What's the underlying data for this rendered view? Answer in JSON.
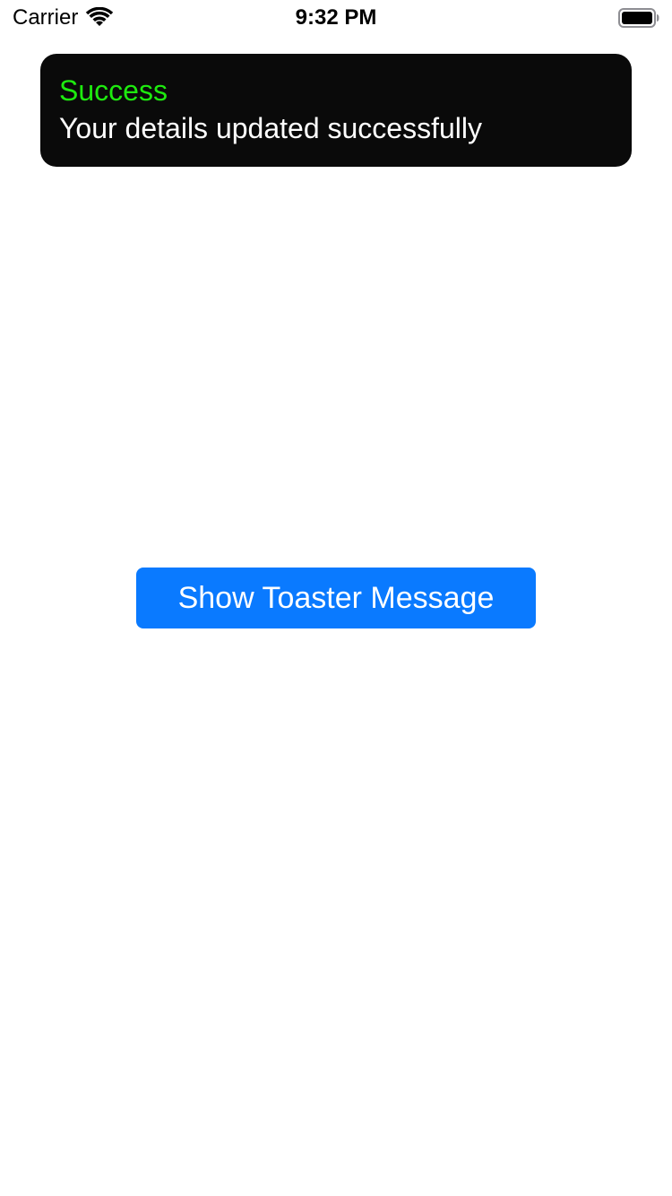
{
  "status_bar": {
    "carrier": "Carrier",
    "time": "9:32 PM",
    "wifi_icon": "wifi-icon",
    "battery_icon": "battery-icon"
  },
  "toast": {
    "title": "Success",
    "message": "Your details updated successfully",
    "title_color": "#1eea0f",
    "background_color": "#0a0a0a"
  },
  "main": {
    "button_label": "Show Toaster Message",
    "button_color": "#0a7aff"
  }
}
